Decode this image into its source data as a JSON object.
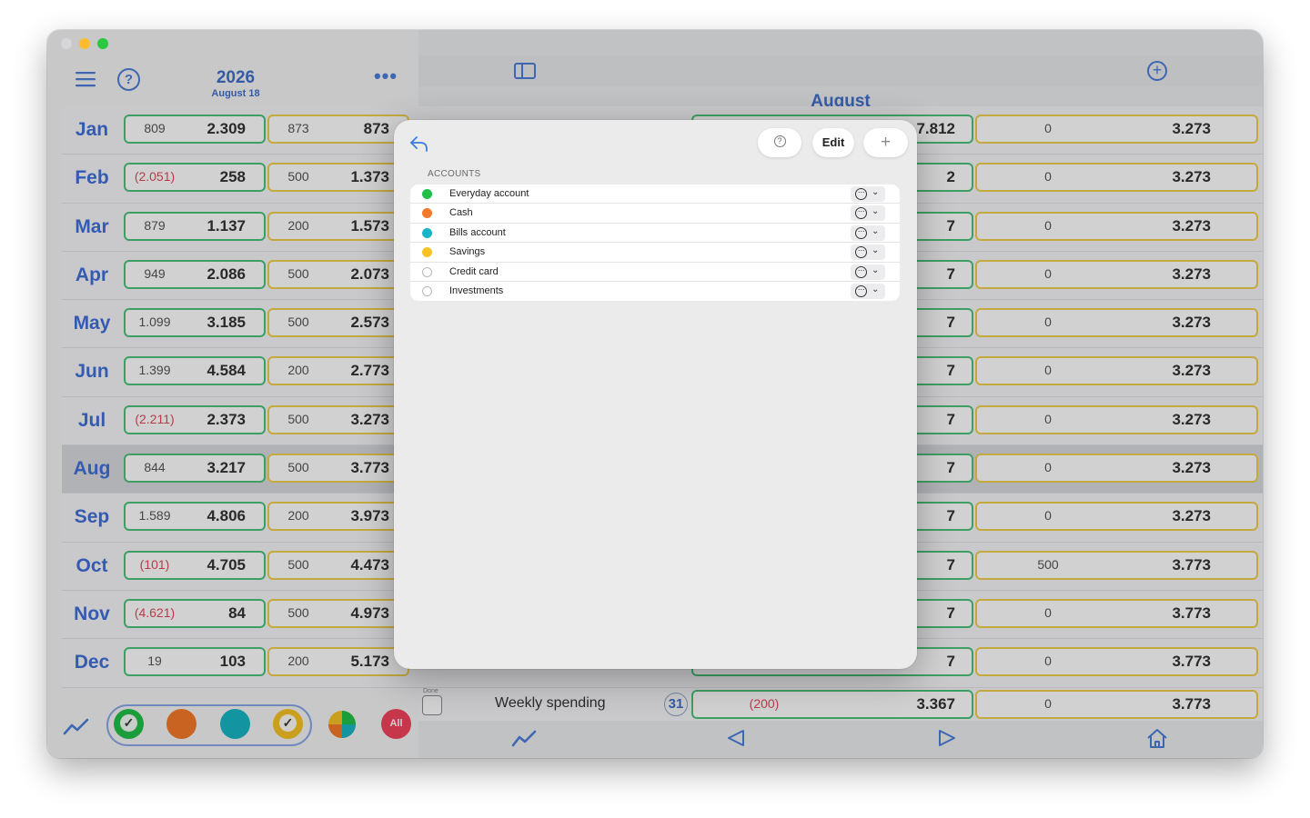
{
  "sidebar": {
    "year": "2026",
    "date": "August 18",
    "months": [
      {
        "name": "Jan",
        "small1": "809",
        "neg1": false,
        "big1": "2.309",
        "small2": "873",
        "big2": "873"
      },
      {
        "name": "Feb",
        "small1": "(2.051)",
        "neg1": true,
        "big1": "258",
        "small2": "500",
        "big2": "1.373"
      },
      {
        "name": "Mar",
        "small1": "879",
        "neg1": false,
        "big1": "1.137",
        "small2": "200",
        "big2": "1.573"
      },
      {
        "name": "Apr",
        "small1": "949",
        "neg1": false,
        "big1": "2.086",
        "small2": "500",
        "big2": "2.073"
      },
      {
        "name": "May",
        "small1": "1.099",
        "neg1": false,
        "big1": "3.185",
        "small2": "500",
        "big2": "2.573"
      },
      {
        "name": "Jun",
        "small1": "1.399",
        "neg1": false,
        "big1": "4.584",
        "small2": "200",
        "big2": "2.773"
      },
      {
        "name": "Jul",
        "small1": "(2.211)",
        "neg1": true,
        "big1": "2.373",
        "small2": "500",
        "big2": "3.273"
      },
      {
        "name": "Aug",
        "small1": "844",
        "neg1": false,
        "big1": "3.217",
        "small2": "500",
        "big2": "3.773"
      },
      {
        "name": "Sep",
        "small1": "1.589",
        "neg1": false,
        "big1": "4.806",
        "small2": "200",
        "big2": "3.973"
      },
      {
        "name": "Oct",
        "small1": "(101)",
        "neg1": true,
        "big1": "4.705",
        "small2": "500",
        "big2": "4.473"
      },
      {
        "name": "Nov",
        "small1": "(4.621)",
        "neg1": true,
        "big1": "84",
        "small2": "500",
        "big2": "4.973"
      },
      {
        "name": "Dec",
        "small1": "19",
        "neg1": false,
        "big1": "103",
        "small2": "200",
        "big2": "5.173"
      }
    ],
    "filter_all_label": "All"
  },
  "main": {
    "month_title": "August",
    "rows": [
      {
        "partial": "7.812",
        "small": "0",
        "big": "3.273"
      },
      {
        "partial": "2",
        "small": "0",
        "big": "3.273"
      },
      {
        "partial": "7",
        "small": "0",
        "big": "3.273"
      },
      {
        "partial": "7",
        "small": "0",
        "big": "3.273"
      },
      {
        "partial": "7",
        "small": "0",
        "big": "3.273"
      },
      {
        "partial": "7",
        "small": "0",
        "big": "3.273"
      },
      {
        "partial": "7",
        "small": "0",
        "big": "3.273"
      },
      {
        "partial": "7",
        "small": "0",
        "big": "3.273"
      },
      {
        "partial": "7",
        "small": "0",
        "big": "3.273"
      },
      {
        "partial": "7",
        "small": "500",
        "big": "3.773"
      },
      {
        "partial": "7",
        "small": "0",
        "big": "3.773"
      },
      {
        "partial": "7",
        "small": "0",
        "big": "3.773"
      }
    ],
    "weekly": {
      "done_label": "Done",
      "label": "Weekly spending",
      "day": "31",
      "amount": "(200)",
      "balance": "3.367",
      "small": "0",
      "big": "3.773"
    }
  },
  "modal": {
    "edit_label": "Edit",
    "add_label": "+",
    "help_label": "?",
    "section_label": "ACCOUNTS",
    "accounts": [
      {
        "name": "Everyday account",
        "color": "#22c04a"
      },
      {
        "name": "Cash",
        "color": "#f5792a"
      },
      {
        "name": "Bills account",
        "color": "#17b5c5"
      },
      {
        "name": "Savings",
        "color": "#f7c325"
      },
      {
        "name": "Credit card",
        "color": ""
      },
      {
        "name": "Investments",
        "color": ""
      }
    ]
  },
  "colors": {
    "accent": "#4170c9",
    "green_box": "#4cc37a",
    "yellow_box": "#f0cf4c",
    "negative": "#e04a58"
  }
}
